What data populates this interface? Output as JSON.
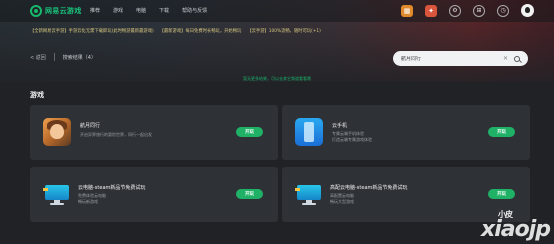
{
  "brand": {
    "name": "网易云游戏",
    "accent": "#1fb267"
  },
  "nav": {
    "items": [
      "推荐",
      "游戏",
      "电脑",
      "下载",
      "帮助与反馈"
    ]
  },
  "nav_icons": [
    "store-icon",
    "gift-icon",
    "settings-icon",
    "grid-icon",
    "clock-icon",
    "avatar"
  ],
  "ticker": {
    "items": [
      "【全新网易云手游】手游云化无需下载即玩(此时畅游最新最游戏)",
      "【最新游戏】每日免费时长畅玩，开始畅玩",
      "【云手游】100%流畅，随时可玩(+1)"
    ]
  },
  "subbar": {
    "back_label": "< 返回",
    "results_label": "搜索结果（4）"
  },
  "search": {
    "value": "航月同行",
    "clear": "✕"
  },
  "notice": "暂无更多结果，可以去其它频道看看哦",
  "section": {
    "title": "游戏"
  },
  "cards": [
    {
      "title": "航月同行",
      "desc1": "开启异界旅行的冒险世界，同行一起出发",
      "desc2": "",
      "button": "开玩"
    },
    {
      "title": "云手机",
      "desc1": "专属云端手机体验",
      "desc2": "打造云端专属游戏体验",
      "button": "开玩"
    },
    {
      "title": "云电脑-steam新品节免费试玩",
      "desc1": "免费体验云电脑",
      "desc2": "畅玩新游戏",
      "button": "开玩"
    },
    {
      "title": "高配云电脑-steam新品节免费试玩",
      "desc1": "高配置云电脑",
      "desc2": "畅玩大型游戏",
      "button": "开玩"
    }
  ],
  "watermark": {
    "main": "xiaojp",
    "small": "小皮"
  }
}
